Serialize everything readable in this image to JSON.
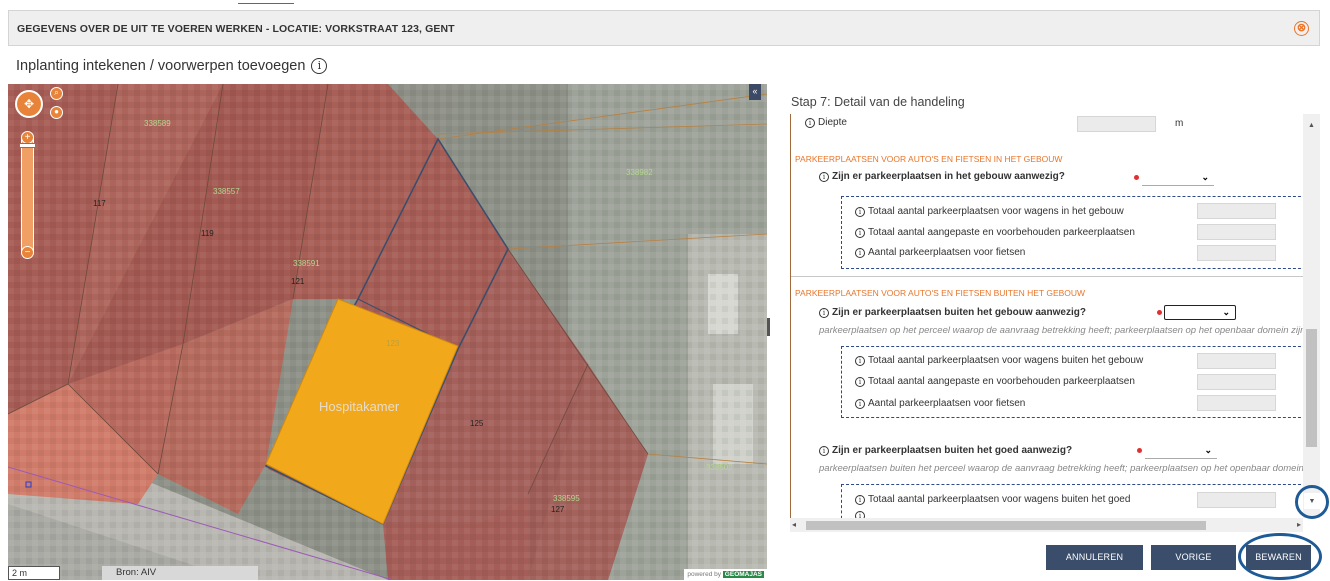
{
  "dialog": {
    "title": "GEGEVENS OVER DE UIT TE VOEREN WERKEN - LOCATIE: VORKSTRAAT 123, GENT",
    "close_symbol": "⊗",
    "subtitle": "Inplanting intekenen / voorwerpen toevoegen",
    "info_symbol": "i"
  },
  "map": {
    "labels": {
      "parcel_tl": "338589",
      "house_117": "117",
      "parcel_mid1": "338557",
      "house_119": "119",
      "parcel_mid2": "338591",
      "house_121": "121",
      "parcel_right": "338982",
      "parcel_123": "123",
      "drawn_object": "Hospitakamer",
      "house_125": "125",
      "parcel_far_right": "338502",
      "parcel_bottom": "338595",
      "house_127": "127"
    },
    "collapse_symbol": "«",
    "scale": "2 m",
    "source": "Bron: AIV",
    "powered_by": "powered by",
    "powered_brand": "GEOMAJAS",
    "colors": {
      "drawn_object_fill": "#f2a81b",
      "parcel_fill": "#a96259",
      "accent": "#e8843a"
    }
  },
  "panel": {
    "step_title": "Stap 7: Detail van de handeling",
    "diepte_label": "Diepte",
    "diepte_unit": "m",
    "section_inside": "PARKEERPLAATSEN VOOR AUTO'S EN FIETSEN IN HET GEBOUW",
    "q_inside": "Zijn er parkeerplaatsen in het gebouw aanwezig?",
    "inside_fields": [
      "Totaal aantal parkeerplaatsen voor wagens in het gebouw",
      "Totaal aantal aangepaste en voorbehouden parkeerplaatsen",
      "Aantal parkeerplaatsen voor fietsen"
    ],
    "section_outside": "PARKEERPLAATSEN VOOR AUTO'S EN FIETSEN BUITEN HET GEBOUW",
    "q_outside": "Zijn er parkeerplaatsen buiten het gebouw aanwezig?",
    "hint_outside": "parkeerplaatsen op het perceel waarop de aanvraag betrekking heeft; parkeerplaatsen op het openbaar domein zijn",
    "outside_fields": [
      "Totaal aantal parkeerplaatsen voor wagens buiten het gebouw",
      "Totaal aantal aangepaste en voorbehouden parkeerplaatsen",
      "Aantal parkeerplaatsen voor fietsen"
    ],
    "q_goed": "Zijn er parkeerplaatsen buiten het goed aanwezig?",
    "hint_goed": "parkeerplaatsen buiten het perceel waarop de aanvraag betrekking heeft; parkeerplaatsen op het openbaar domein z",
    "goed_fields": [
      "Totaal aantal parkeerplaatsen voor wagens buiten het goed"
    ],
    "dropdown_symbol": "⌄"
  },
  "footer": {
    "cancel": "ANNULEREN",
    "previous": "VORIGE",
    "save": "BEWAREN"
  }
}
